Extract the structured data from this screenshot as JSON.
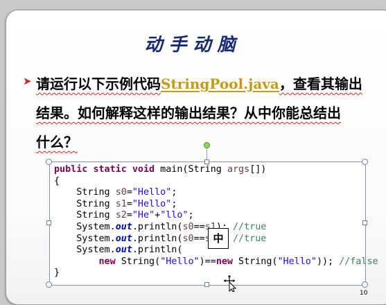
{
  "slide": {
    "title": "动手动脑",
    "bullet": {
      "prefix": "请运行以下示例代码",
      "link_text": "StringPool.java",
      "line1_rest": "，查看其输出",
      "line2": "结果。如何解释这样的输出结果？从中你能总结出",
      "line3": "什么？"
    },
    "page_number": "10"
  },
  "code": {
    "line1": {
      "kw1": "public",
      "kw2": "static",
      "kw3": "void",
      "rest": " main(String ",
      "var": "args",
      "end": "[])"
    },
    "line2": "{",
    "line3": {
      "type": "String ",
      "var": "s0",
      "eq": "=",
      "str": "\"Hello\"",
      "end": ";"
    },
    "line4": {
      "type": "String ",
      "var": "s1",
      "eq": "=",
      "str": "\"Hello\"",
      "end": ";"
    },
    "line5": {
      "type": "String ",
      "var": "s2",
      "eq": "=",
      "str": "\"He\"",
      "plus": "+",
      "str2": "\"llo\"",
      "end": ";"
    },
    "line6": {
      "cls": "System.",
      "fld": "out",
      "call": ".println(",
      "var1": "s0",
      "op": "==",
      "var2": "s1",
      "end": "); ",
      "cmt": "//true"
    },
    "line7": {
      "cls": "System.",
      "fld": "out",
      "call": ".println(",
      "var1": "s0",
      "op": "==",
      "var2": "s2",
      "end": "); ",
      "cmt": "//true"
    },
    "line8": {
      "cls": "System.",
      "fld": "out",
      "call": ".println("
    },
    "line9": {
      "kw1": "new",
      "a": " String(",
      "s1": "\"Hello\"",
      "b": ")==",
      "kw2": "new",
      "c": " String(",
      "s2": "\"Hello\"",
      "d": ")); ",
      "cmt": "//false"
    },
    "line10": "}"
  },
  "ime_indicator": "中",
  "icons": {
    "bullet": "arrowhead-bullet-icon",
    "rotate": "rotate-handle-icon",
    "cursor": "move-cursor-icon"
  },
  "colors": {
    "title": "#1b2a78",
    "link": "#c79a12",
    "bullet_arrow": "#c62a1c",
    "keyword": "#7f0055",
    "string": "#2a00ff",
    "comment": "#3f7f5f",
    "selection_border": "#7f93b1",
    "rotate_handle": "#8fd35a"
  }
}
